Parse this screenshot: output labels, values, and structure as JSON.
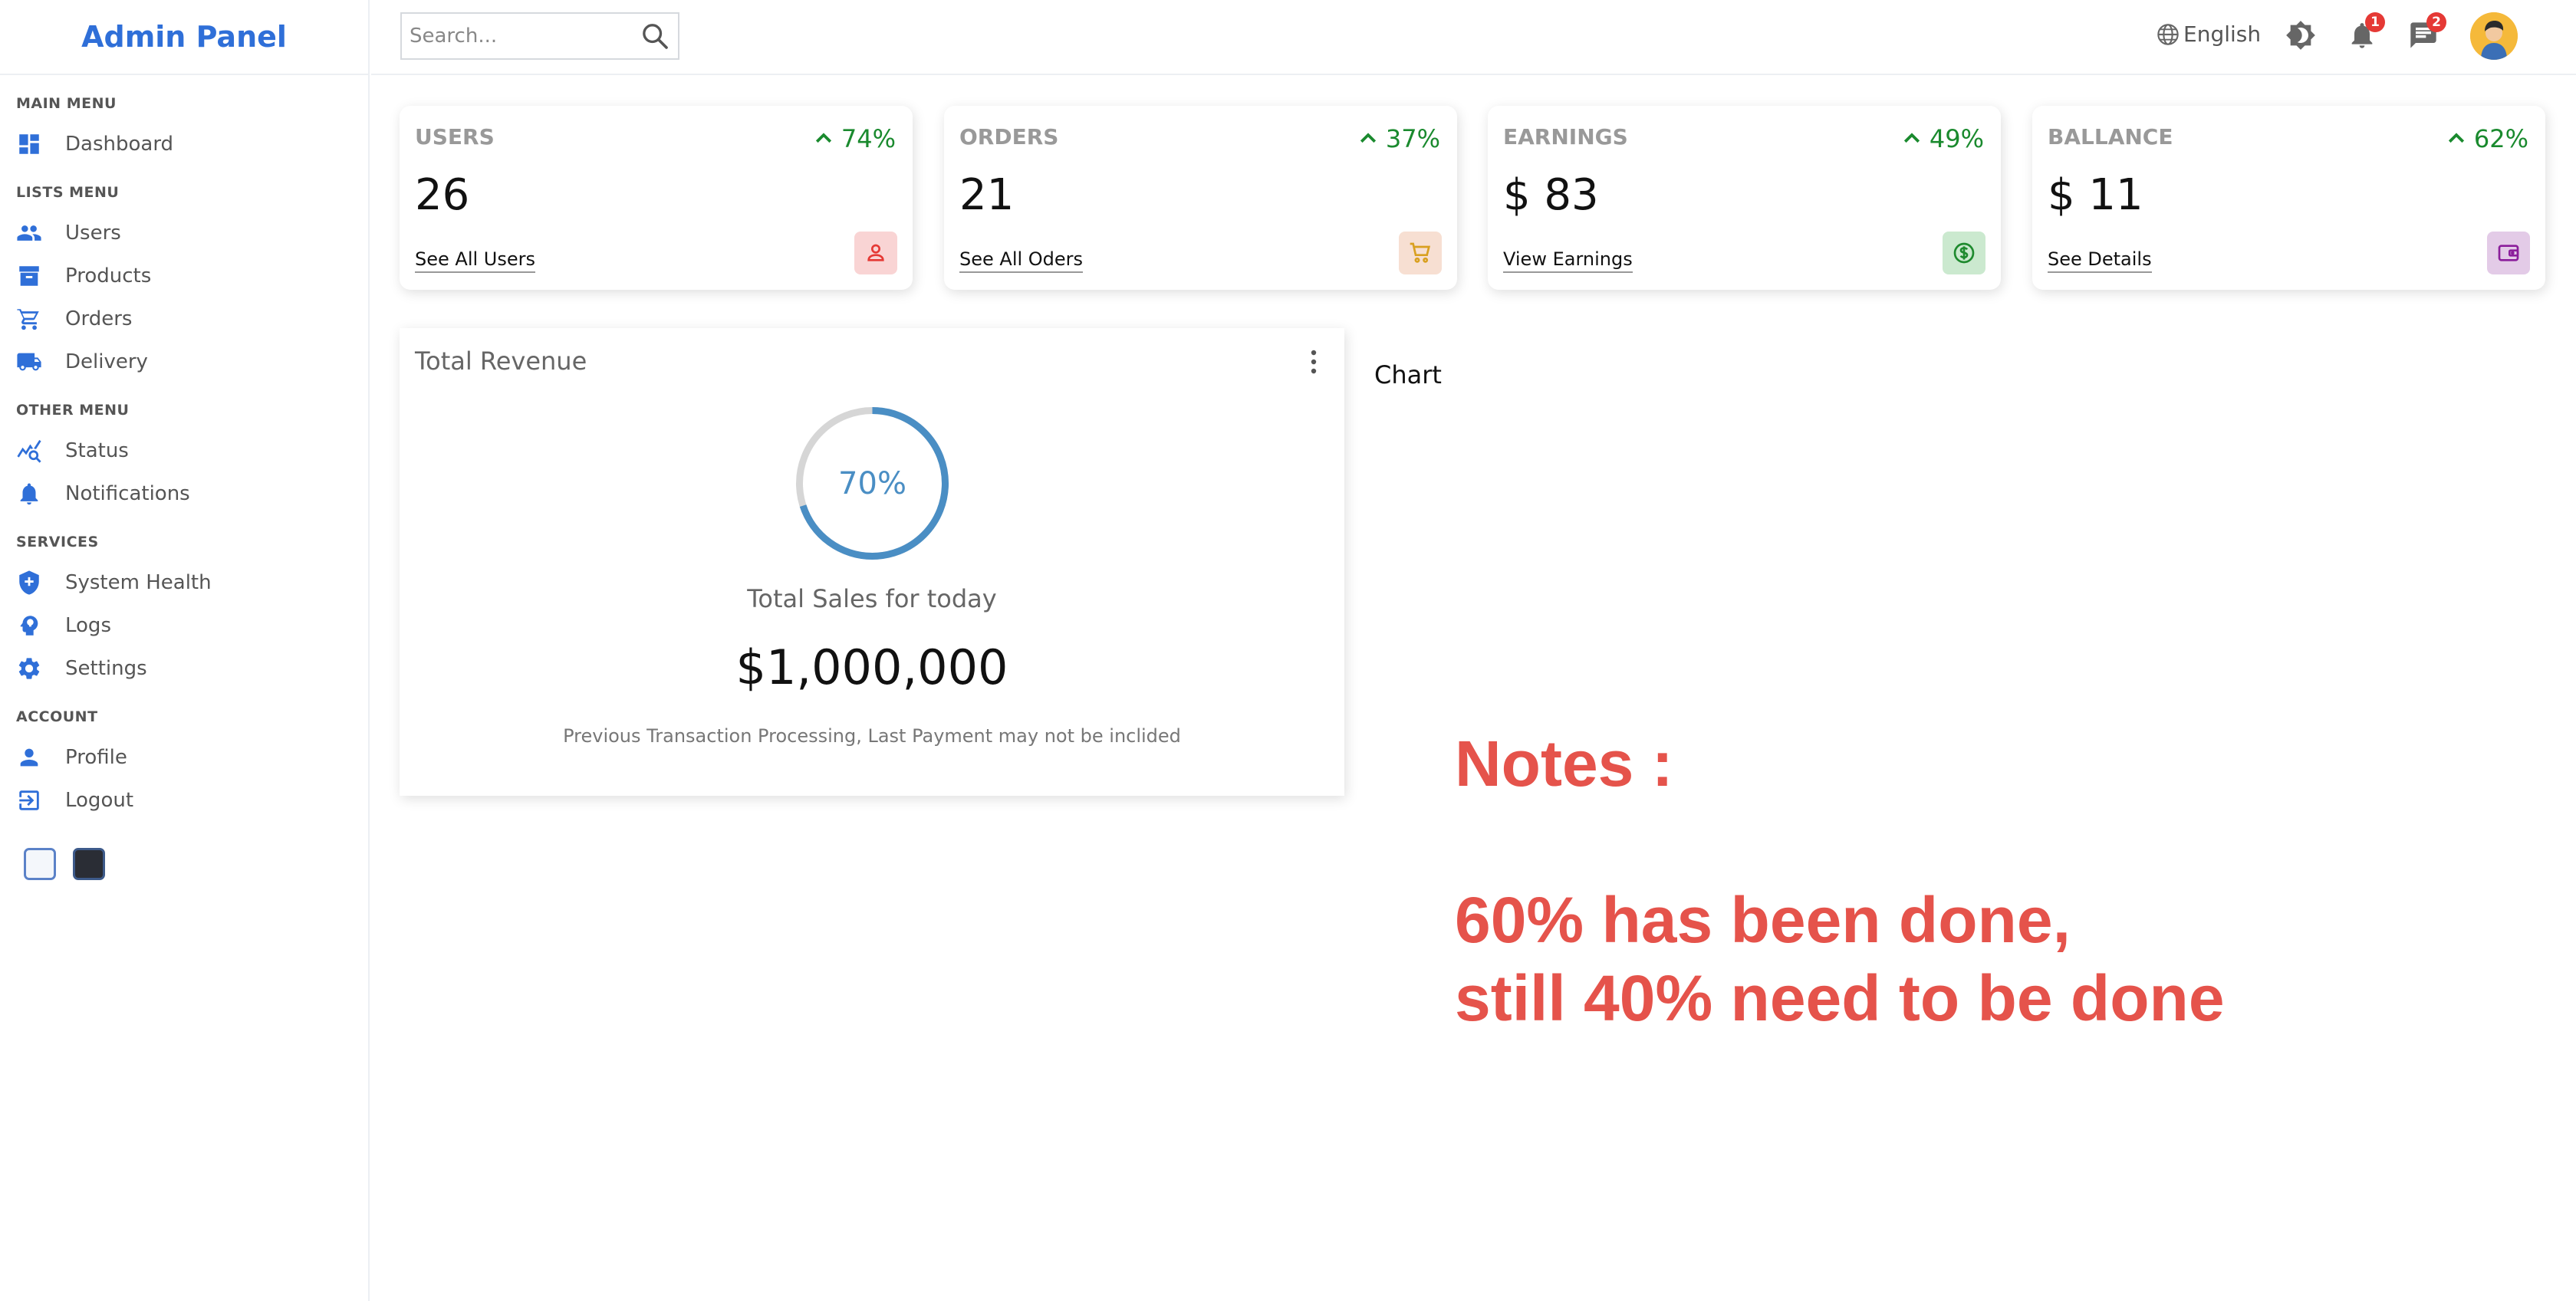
{
  "sidebar": {
    "logo": "Admin Panel",
    "sections": [
      {
        "title": "MAIN MENU",
        "items": [
          {
            "label": "Dashboard",
            "icon": "dashboard-icon"
          }
        ]
      },
      {
        "title": "LISTS MENU",
        "items": [
          {
            "label": "Users",
            "icon": "users-icon"
          },
          {
            "label": "Products",
            "icon": "archive-icon"
          },
          {
            "label": "Orders",
            "icon": "cart-icon"
          },
          {
            "label": "Delivery",
            "icon": "truck-icon"
          }
        ]
      },
      {
        "title": "OTHER MENU",
        "items": [
          {
            "label": "Status",
            "icon": "chart-search-icon"
          },
          {
            "label": "Notifications",
            "icon": "bell-icon"
          }
        ]
      },
      {
        "title": "SERVICES",
        "items": [
          {
            "label": "System Health",
            "icon": "shield-plus-icon"
          },
          {
            "label": "Logs",
            "icon": "brain-icon"
          },
          {
            "label": "Settings",
            "icon": "gear-icon"
          }
        ]
      },
      {
        "title": "ACCOUNT",
        "items": [
          {
            "label": "Profile",
            "icon": "person-icon"
          },
          {
            "label": "Logout",
            "icon": "logout-icon"
          }
        ]
      }
    ]
  },
  "topbar": {
    "search_placeholder": "Search...",
    "language": "English",
    "notifications_count": "1",
    "messages_count": "2"
  },
  "widgets": [
    {
      "title": "USERS",
      "percent": "74%",
      "value": "26",
      "link": "See All Users",
      "icon": "person-outline-icon",
      "icon_color": "#e53935",
      "icon_bg": "#f9d4d4"
    },
    {
      "title": "ORDERS",
      "percent": "37%",
      "value": "21",
      "link": "See All Oders",
      "icon": "cart-icon",
      "icon_color": "#d9a020",
      "icon_bg": "#f7dfd2"
    },
    {
      "title": "EARNINGS",
      "percent": "49%",
      "value": "$ 83",
      "link": "View Earnings",
      "icon": "dollar-icon",
      "icon_color": "#1e8a2e",
      "icon_bg": "#cbe9cf"
    },
    {
      "title": "BALLANCE",
      "percent": "62%",
      "value": "$ 11",
      "link": "See Details",
      "icon": "wallet-icon",
      "icon_color": "#8b1e9b",
      "icon_bg": "#e3cbe7"
    }
  ],
  "revenue": {
    "title": "Total Revenue",
    "progress_percent": 70,
    "progress_label": "70%",
    "subtitle": "Total Sales for today",
    "amount": "$1,000,000",
    "note": "Previous Transaction Processing, Last Payment may not be inclided"
  },
  "chart_label": "Chart",
  "notes": {
    "line1": "Notes :",
    "line2": "60% has been done,",
    "line3": "still 40% need to be done",
    "color": "#e5534b"
  },
  "colors": {
    "accent": "#2f6fd8",
    "positive": "#1a8a2e",
    "ring": "#4a8ec4"
  }
}
